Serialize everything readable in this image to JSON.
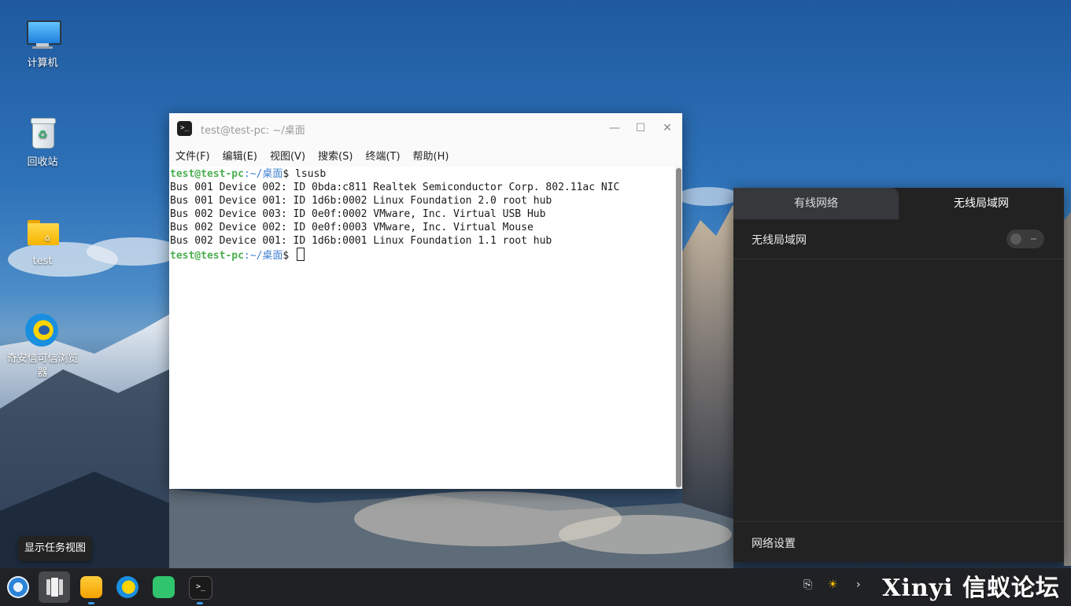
{
  "desktop": {
    "icons": [
      {
        "label": "计算机",
        "icon": "computer-icon"
      },
      {
        "label": "回收站",
        "icon": "trash-icon"
      },
      {
        "label": "test",
        "icon": "folder-icon"
      },
      {
        "label": "奇安信可信浏览器",
        "icon": "browser-icon"
      }
    ]
  },
  "terminal": {
    "title": "test@test-pc: ~/桌面",
    "menu": [
      "文件(F)",
      "编辑(E)",
      "视图(V)",
      "搜索(S)",
      "终端(T)",
      "帮助(H)"
    ],
    "prompt_user": "test@test-pc",
    "prompt_path": ":~/桌面",
    "prompt_symbol": "$",
    "command": " lsusb",
    "output": [
      "Bus 001 Device 002: ID 0bda:c811 Realtek Semiconductor Corp. 802.11ac NIC",
      "Bus 001 Device 001: ID 1d6b:0002 Linux Foundation 2.0 root hub",
      "Bus 002 Device 003: ID 0e0f:0002 VMware, Inc. Virtual USB Hub",
      "Bus 002 Device 002: ID 0e0f:0003 VMware, Inc. Virtual Mouse",
      "Bus 002 Device 001: ID 1d6b:0001 Linux Foundation 1.1 root hub"
    ]
  },
  "network_panel": {
    "tabs": [
      "有线网络",
      "无线局域网"
    ],
    "active_tab": "无线局域网",
    "wifi_label": "无线局域网",
    "wifi_enabled": false,
    "settings_label": "网络设置"
  },
  "tooltip": "显示任务视图",
  "taskbar": {
    "apps": [
      "launcher-icon",
      "task-view-icon",
      "file-manager-icon",
      "browser-icon",
      "chat-icon",
      "terminal-icon"
    ],
    "watermark": "Xinyi 信蚁论坛"
  }
}
